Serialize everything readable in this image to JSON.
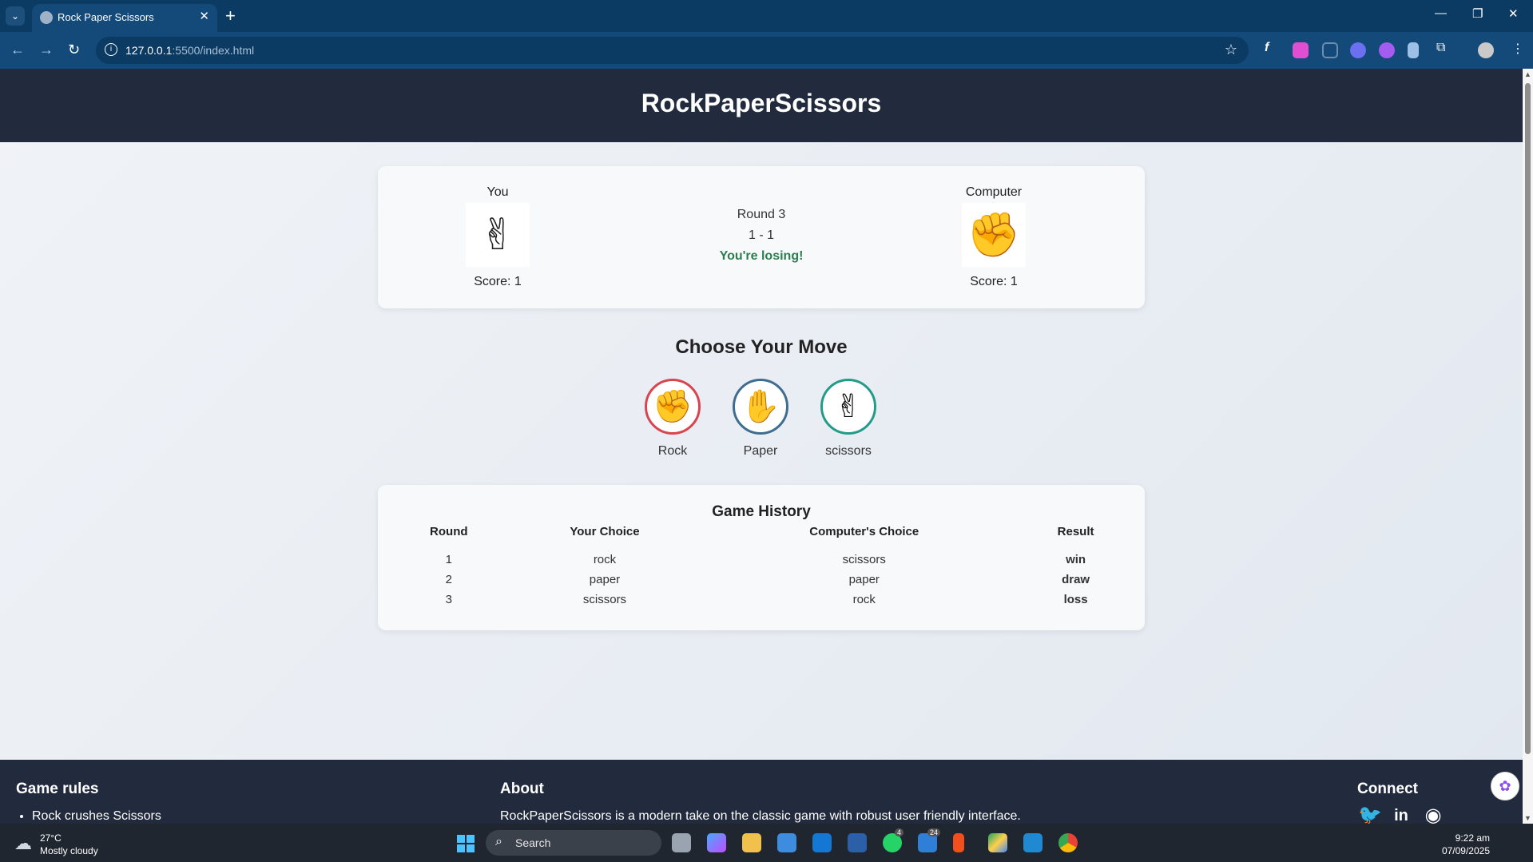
{
  "browser": {
    "tab_title": "Rock Paper Scissors",
    "new_tab": "+",
    "url_host": "127.0.0.1",
    "url_rest": ":5500/index.html"
  },
  "site": {
    "title": "RockPaperScissors"
  },
  "scoreboard": {
    "you_label": "You",
    "computer_label": "Computer",
    "you_hand": "✌",
    "computer_hand": "✊",
    "you_score": "Score: 1",
    "computer_score": "Score: 1",
    "round": "Round 3",
    "score_line": "1 - 1",
    "status_message": "You're losing!"
  },
  "moves": {
    "title": "Choose Your Move",
    "items": [
      {
        "label": "Rock",
        "glyph": "✊",
        "color": "#d9444e"
      },
      {
        "label": "Paper",
        "glyph": "✋",
        "color": "#3f6d8f"
      },
      {
        "label": "scissors",
        "glyph": "✌",
        "color": "#239b88"
      }
    ]
  },
  "history": {
    "title": "Game History",
    "columns": [
      "Round",
      "Your Choice",
      "Computer's Choice",
      "Result"
    ],
    "rows": [
      [
        "1",
        "rock",
        "scissors",
        "win"
      ],
      [
        "2",
        "paper",
        "paper",
        "draw"
      ],
      [
        "3",
        "scissors",
        "rock",
        "loss"
      ]
    ],
    "result_colors": {
      "win": "#2e7d4f",
      "draw": "#d83a3a",
      "loss": "#d83a3a"
    }
  },
  "footer": {
    "rules_heading": "Game rules",
    "rules_first": "Rock crushes Scissors",
    "about_heading": "About",
    "about_text": "RockPaperScissors is a modern take on the classic game with robust user friendly interface.",
    "connect_heading": "Connect",
    "social_icons": [
      "twitter-icon",
      "linkedin-icon",
      "discord-icon"
    ]
  },
  "taskbar": {
    "temperature": "27°C",
    "weather": "Mostly cloudy",
    "search_placeholder": "Search",
    "badge_whatsapp": "4",
    "badge_outlook": "24",
    "time": "9:22 am",
    "date": "07/09/2025"
  },
  "colors": {
    "header_bg": "#222b3d",
    "accent_green": "#2e7d4f",
    "accent_red": "#d83a3a"
  }
}
